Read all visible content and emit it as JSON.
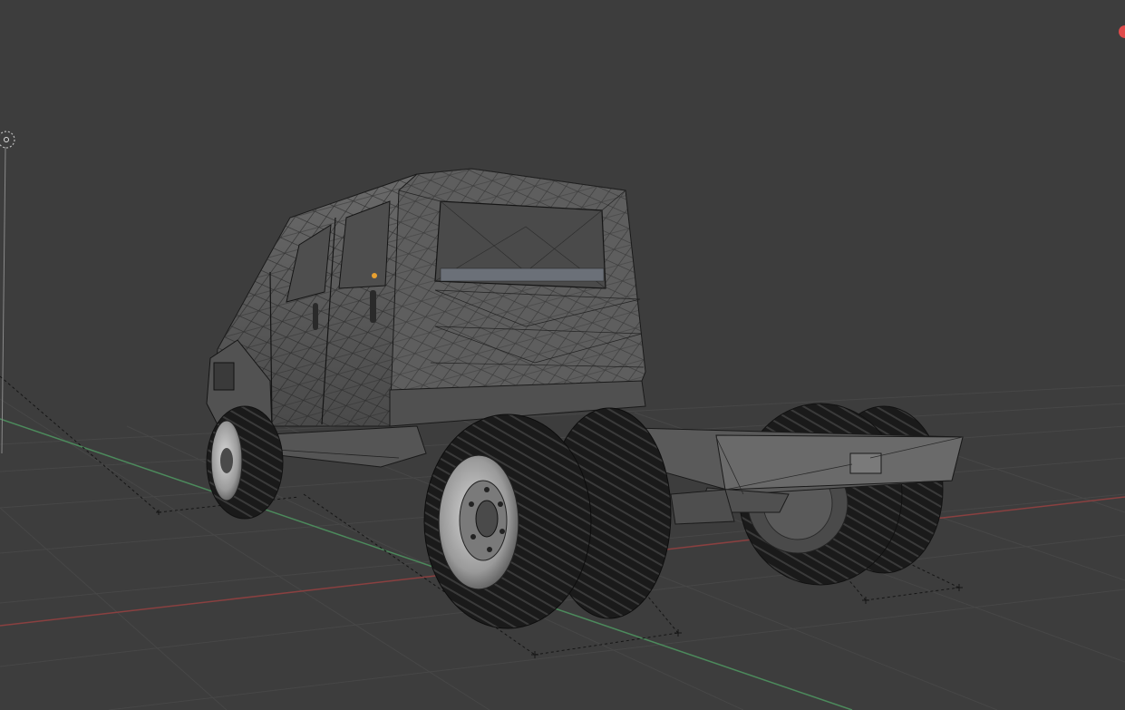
{
  "viewport": {
    "background": "#3d3d3d",
    "grid_color": "#4a4a4a",
    "x_axis_color": "#a04848",
    "y_axis_color": "#4c8a5c",
    "indicator_color": "#e04a4a",
    "origin_color": "#e8a030"
  },
  "scene": {
    "object": "truck-chassis-cab-model",
    "shading": "solid-with-wireframe-overlay",
    "light": "light-object-icon",
    "camera_guides": "dotted-helper-lines"
  }
}
